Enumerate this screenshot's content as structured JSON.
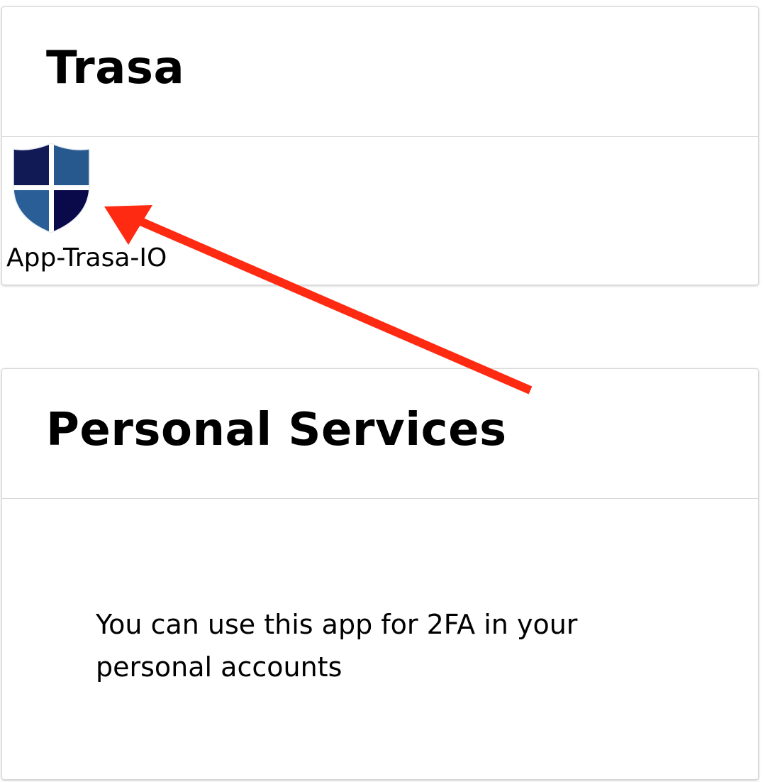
{
  "trasa_card": {
    "title": "Trasa",
    "app": {
      "label": "App-Trasa-IO",
      "icon": "shield-icon",
      "icon_colors": [
        "#121a56",
        "#27588e",
        "#2a5e96",
        "#0a0a4a"
      ]
    }
  },
  "personal_card": {
    "title": "Personal Services",
    "description": "You can use this app for 2FA in your personal accounts"
  },
  "annotation": {
    "icon": "arrow-icon",
    "color": "#ff2a12"
  }
}
